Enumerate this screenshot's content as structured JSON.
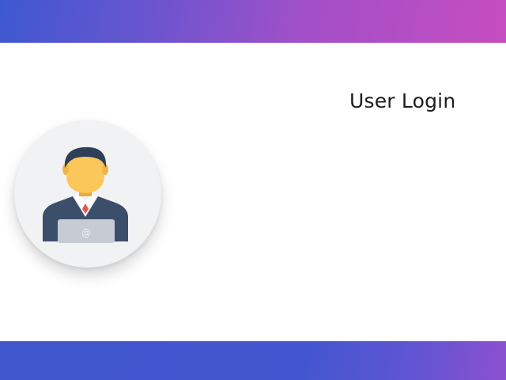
{
  "header": {
    "gradient_start": "#3e58d0",
    "gradient_end": "#c64dc0"
  },
  "login": {
    "title": "User Login"
  },
  "avatar": {
    "icon": "user-with-laptop-icon",
    "laptop_symbol": "@"
  },
  "footer": {
    "gradient_start": "#3f56cc",
    "gradient_end": "#8d50cf"
  },
  "colors": {
    "suit": "#3b4f6b",
    "face": "#fbc75b",
    "hair": "#2f3f58",
    "tie": "#e4584b",
    "laptop": "#c6cbd4"
  }
}
